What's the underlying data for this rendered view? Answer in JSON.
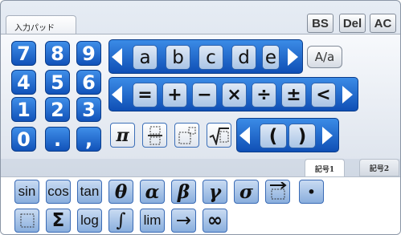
{
  "panel": {
    "title": "入力パッド"
  },
  "commands": {
    "backspace": "BS",
    "delete": "Del",
    "all_clear": "AC"
  },
  "numpad": {
    "keys": [
      "7",
      "8",
      "9",
      "4",
      "5",
      "6",
      "1",
      "2",
      "3",
      "0",
      ".",
      ","
    ]
  },
  "letters": {
    "keys": [
      "a",
      "b",
      "c",
      "d",
      "e"
    ],
    "case_toggle": "A/a"
  },
  "operators": {
    "keys": [
      "=",
      "+",
      "−",
      "×",
      "÷",
      "±",
      "<"
    ]
  },
  "special": {
    "pi": "π",
    "parens": [
      "(",
      ")"
    ]
  },
  "tabs": {
    "kigou1": "記号1",
    "kigou2": "記号2"
  },
  "symbols": {
    "row1": [
      "sin",
      "cos",
      "tan",
      "θ",
      "α",
      "β",
      "γ",
      "σ"
    ],
    "dot": "•",
    "row2": [
      "Σ",
      "log",
      "∫",
      "lim",
      "→",
      "∞"
    ]
  },
  "colors": {
    "key_blue": "#1a5fc4",
    "letter_key": "#c7d9f0",
    "symbol_key": "#a9c4e8",
    "background": "#dde3ec"
  },
  "icons": [
    "left-arrow-icon",
    "right-arrow-icon",
    "fraction-icon",
    "exponent-icon",
    "root-icon",
    "vector-arrow-icon",
    "box-icon"
  ]
}
